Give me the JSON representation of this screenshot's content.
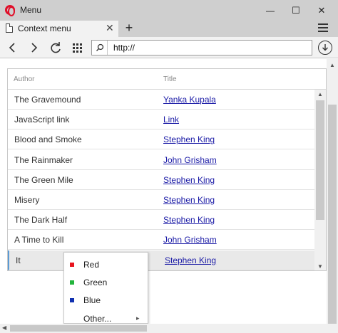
{
  "window": {
    "title": "Menu",
    "minimize_glyph": "—",
    "maximize_glyph": "☐",
    "close_glyph": "✕"
  },
  "tab": {
    "label": "Context menu",
    "close_glyph": "✕",
    "new_tab_glyph": "+"
  },
  "address": {
    "url": "http://"
  },
  "grid": {
    "columns": [
      "Author",
      "Title"
    ],
    "rows": [
      {
        "author": "The Gravemound",
        "title": "Yanka Kupala"
      },
      {
        "author": "JavaScript link",
        "title": "Link"
      },
      {
        "author": "Blood and Smoke",
        "title": "Stephen King"
      },
      {
        "author": "The Rainmaker",
        "title": "John Grisham"
      },
      {
        "author": "The Green Mile",
        "title": "Stephen King"
      },
      {
        "author": "Misery",
        "title": "Stephen King"
      },
      {
        "author": "The Dark Half",
        "title": "Stephen King"
      },
      {
        "author": "A Time to Kill",
        "title": "John Grisham"
      },
      {
        "author": "It",
        "title": "Stephen King"
      }
    ],
    "selected_row_index": 8
  },
  "context_menu": {
    "items": [
      {
        "label": "Red",
        "color": "#e8141e"
      },
      {
        "label": "Green",
        "color": "#22b43c"
      },
      {
        "label": "Blue",
        "color": "#1030b0"
      },
      {
        "label": "Other...",
        "submenu_glyph": "▸"
      }
    ]
  },
  "colors": {
    "link": "#1a1aa6",
    "selection_accent": "#5b9bd5",
    "opera_red": "#e0102a"
  }
}
